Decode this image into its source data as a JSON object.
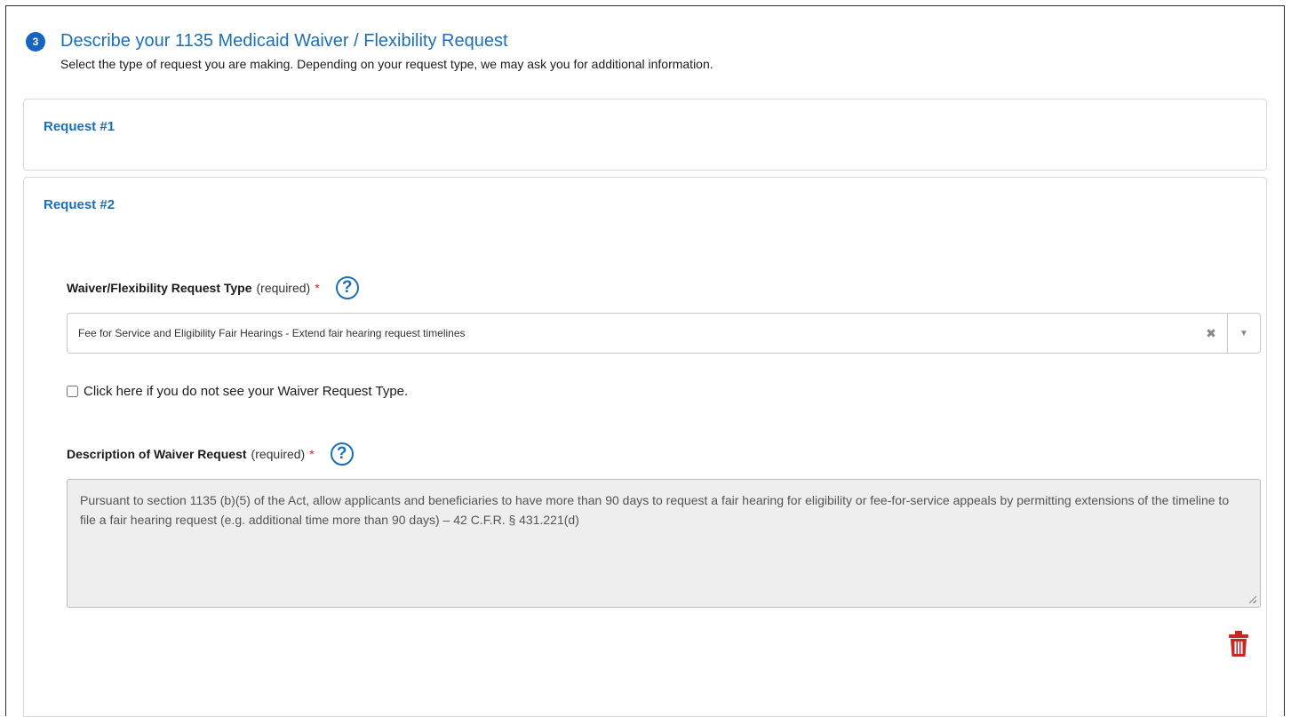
{
  "section": {
    "step_number": "3",
    "title": "Describe your 1135 Medicaid Waiver / Flexibility Request",
    "subtitle": "Select the type of request you are making. Depending on your request type, we may ask you for additional information."
  },
  "requests": [
    {
      "title": "Request #1"
    },
    {
      "title": "Request #2",
      "type_field": {
        "label": "Waiver/Flexibility Request Type",
        "required_text": "(required)",
        "required_marker": "*",
        "selected_value": "Fee for Service and Eligibility Fair Hearings - Extend fair hearing request timelines",
        "clear_glyph": "✖",
        "arrow_glyph": "▼"
      },
      "checkbox_label": "Click here if you do not see your Waiver Request Type.",
      "description_field": {
        "label": "Description of Waiver Request",
        "required_text": "(required)",
        "required_marker": "*",
        "value": "Pursuant to section 1135 (b)(5) of the Act, allow applicants and beneficiaries to have more than 90 days to request a fair hearing for eligibility or fee-for-service appeals by permitting extensions of the timeline to file a fair hearing request (e.g. additional time more than 90 days) – 42 C.F.R. § 431.221(d)"
      }
    }
  ],
  "icons": {
    "help": "question-circle-icon",
    "delete": "trash-icon"
  },
  "colors": {
    "accent": "#1d6fb5",
    "badge": "#1565c0",
    "required": "#c62828",
    "delete": "#c62828",
    "disabled_bg": "#eeeeee"
  }
}
